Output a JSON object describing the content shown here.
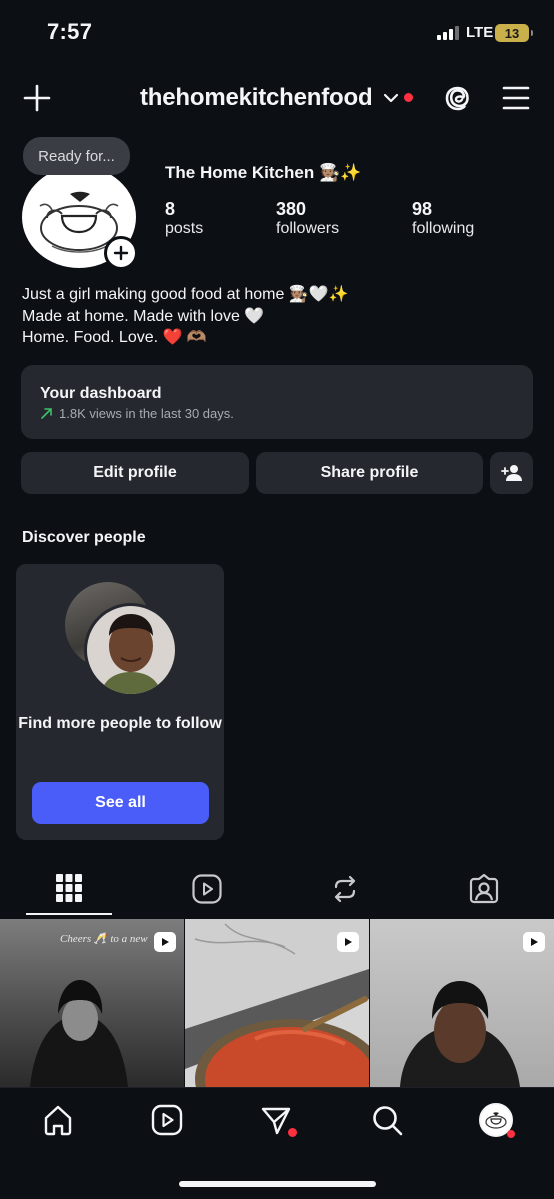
{
  "status": {
    "time": "7:57",
    "network": "LTE",
    "battery": "13"
  },
  "header": {
    "username": "thehomekitchenfood"
  },
  "profile": {
    "note": "Ready for...",
    "display_name": "The Home Kitchen 🧑🏽‍🍳✨",
    "stats": [
      {
        "value": "8",
        "label": "posts"
      },
      {
        "value": "380",
        "label": "followers"
      },
      {
        "value": "98",
        "label": "following"
      }
    ],
    "bio": [
      "Just a girl making good food at home 🧑🏽‍🍳🤍✨",
      "Made at home. Made with love 🤍",
      "Home. Food. Love. ❤️ 🫶🏽"
    ]
  },
  "dashboard": {
    "title": "Your dashboard",
    "subtitle": "1.8K views in the last 30 days."
  },
  "actions": {
    "edit": "Edit profile",
    "share": "Share profile"
  },
  "discover": {
    "title": "Discover people",
    "card_text": "Find more people to follow",
    "button": "See all"
  },
  "tabs": [
    "grid-icon",
    "reels-icon",
    "reposts-icon",
    "tagged-icon"
  ],
  "posts": [
    {
      "caption": "Cheers 🥂 to a new"
    },
    {
      "caption": ""
    },
    {
      "caption": ""
    }
  ],
  "nav": [
    "home-icon",
    "reels-icon",
    "messages-icon",
    "search-icon",
    "profile-avatar"
  ],
  "colors": {
    "background": "#0c0f14",
    "card": "#25282e",
    "accent": "#4a5df9",
    "notification": "#ff3040",
    "trend": "#3ec16c"
  }
}
